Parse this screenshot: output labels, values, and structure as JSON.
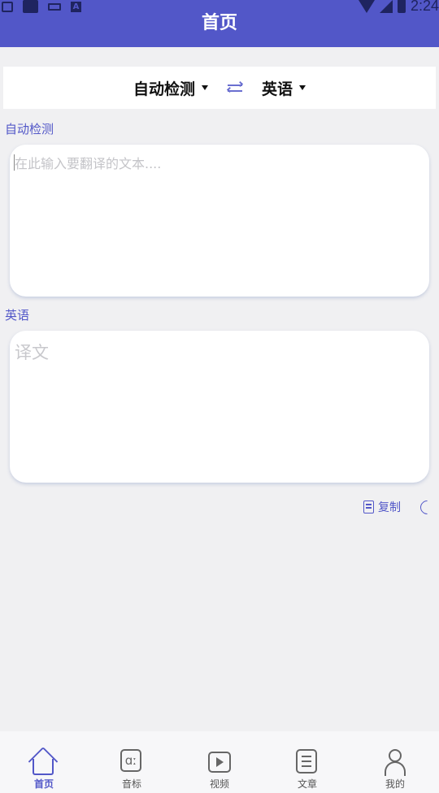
{
  "status_bar": {
    "time": "2:24"
  },
  "header": {
    "title": "首页"
  },
  "lang_bar": {
    "source_lang": "自动检测",
    "target_lang": "英语"
  },
  "source": {
    "label": "自动检测",
    "placeholder": "在此输入要翻译的文本...."
  },
  "target": {
    "label": "英语",
    "placeholder": "译文"
  },
  "actions": {
    "copy_label": "复制"
  },
  "nav": {
    "items": [
      {
        "label": "首页",
        "icon": "home-icon"
      },
      {
        "label": "音标",
        "icon": "phonetic-icon"
      },
      {
        "label": "视频",
        "icon": "video-icon"
      },
      {
        "label": "文章",
        "icon": "article-icon"
      },
      {
        "label": "我的",
        "icon": "profile-icon"
      }
    ],
    "active_index": 0
  },
  "colors": {
    "primary": "#5257c8",
    "background": "#f0f0f2"
  }
}
